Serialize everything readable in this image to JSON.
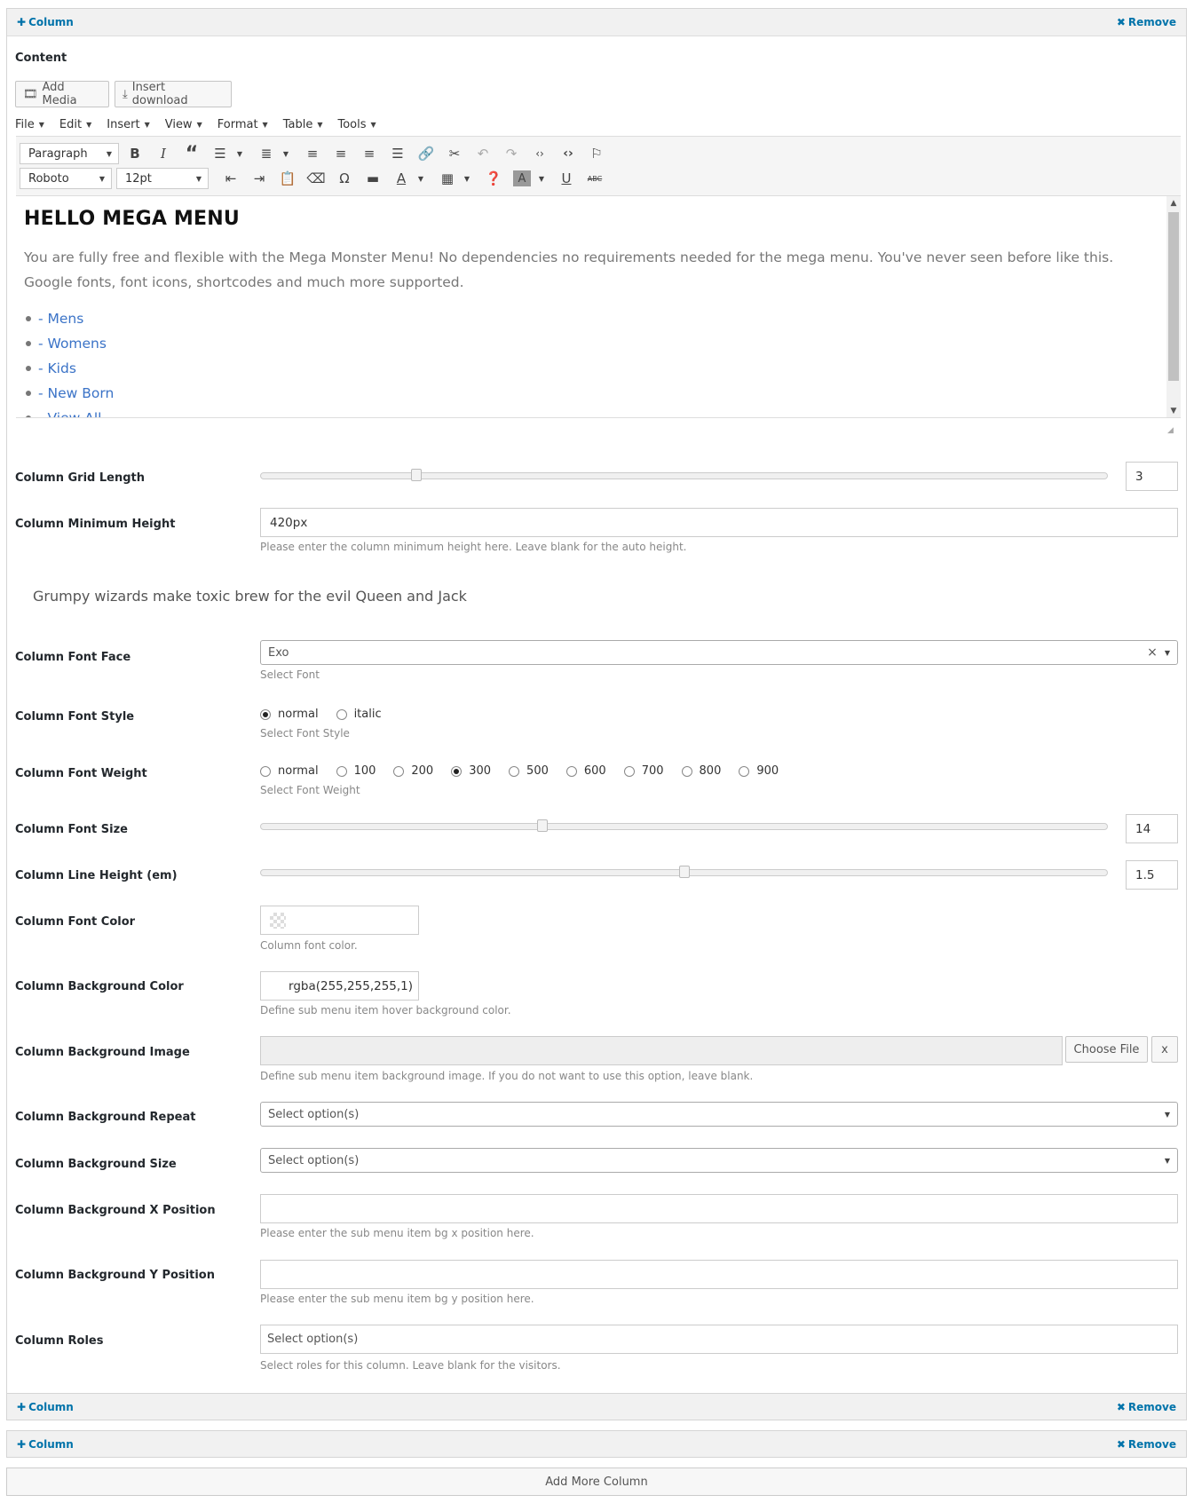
{
  "column_panel": {
    "title": "Column",
    "remove_label": "Remove",
    "content_label": "Content"
  },
  "buttons": {
    "add_media": "Add Media",
    "insert_download": "Insert download"
  },
  "menubar": [
    "File",
    "Edit",
    "Insert",
    "View",
    "Format",
    "Table",
    "Tools"
  ],
  "toolbar": {
    "block_format": "Paragraph",
    "font_family": "Roboto",
    "font_size": "12pt"
  },
  "editor": {
    "heading": "HELLO MEGA MENU",
    "paragraph": "You are fully free and flexible with the Mega Monster Menu! No dependencies no requirements needed for the mega menu. You've never seen before like this. Google fonts, font icons, shortcodes and much more supported.",
    "list_items": [
      "- Mens",
      "- Womens",
      "- Kids",
      "- New Born",
      "- View All"
    ]
  },
  "fields": {
    "grid_length": {
      "label": "Column Grid Length",
      "value": "3",
      "slider_fraction": 0.18
    },
    "min_height": {
      "label": "Column Minimum Height",
      "value": "420px",
      "help": "Please enter the column minimum height here. Leave blank for the auto height."
    },
    "preview_text": "Grumpy wizards make toxic brew for the evil Queen and Jack",
    "font_face": {
      "label": "Column Font Face",
      "value": "Exo",
      "clear": "×",
      "help": "Select Font"
    },
    "font_style": {
      "label": "Column Font Style",
      "options": [
        "normal",
        "italic"
      ],
      "selected": "normal",
      "help": "Select Font Style"
    },
    "font_weight": {
      "label": "Column Font Weight",
      "options": [
        "normal",
        "100",
        "200",
        "300",
        "500",
        "600",
        "700",
        "800",
        "900"
      ],
      "selected": "300",
      "help": "Select Font Weight"
    },
    "font_size": {
      "label": "Column Font Size",
      "value": "14",
      "slider_fraction": 0.33
    },
    "line_height": {
      "label": "Column Line Height (em)",
      "value": "1.5",
      "slider_fraction": 0.5
    },
    "font_color": {
      "label": "Column Font Color",
      "help": "Column font color."
    },
    "bg_color": {
      "label": "Column Background Color",
      "value": "rgba(255,255,255,1)",
      "help": "Define sub menu item hover background color."
    },
    "bg_image": {
      "label": "Column Background Image",
      "choose": "Choose File",
      "clear": "x",
      "help": "Define sub menu item background image. If you do not want to use this option, leave blank."
    },
    "bg_repeat": {
      "label": "Column Background Repeat",
      "placeholder": "Select option(s)"
    },
    "bg_size": {
      "label": "Column Background Size",
      "placeholder": "Select option(s)"
    },
    "bg_x": {
      "label": "Column Background X Position",
      "help": "Please enter the sub menu item bg x position here."
    },
    "bg_y": {
      "label": "Column Background Y Position",
      "help": "Please enter the sub menu item bg y position here."
    },
    "roles": {
      "label": "Column Roles",
      "placeholder": "Select option(s)",
      "help": "Select roles for this column. Leave blank for the visitors."
    }
  },
  "collapsed_columns": [
    {
      "title": "Column",
      "remove_label": "Remove"
    },
    {
      "title": "Column",
      "remove_label": "Remove"
    }
  ],
  "add_more_label": "Add More Column",
  "colors": {
    "link": "#0073aa",
    "list_link": "#3b73c7"
  }
}
